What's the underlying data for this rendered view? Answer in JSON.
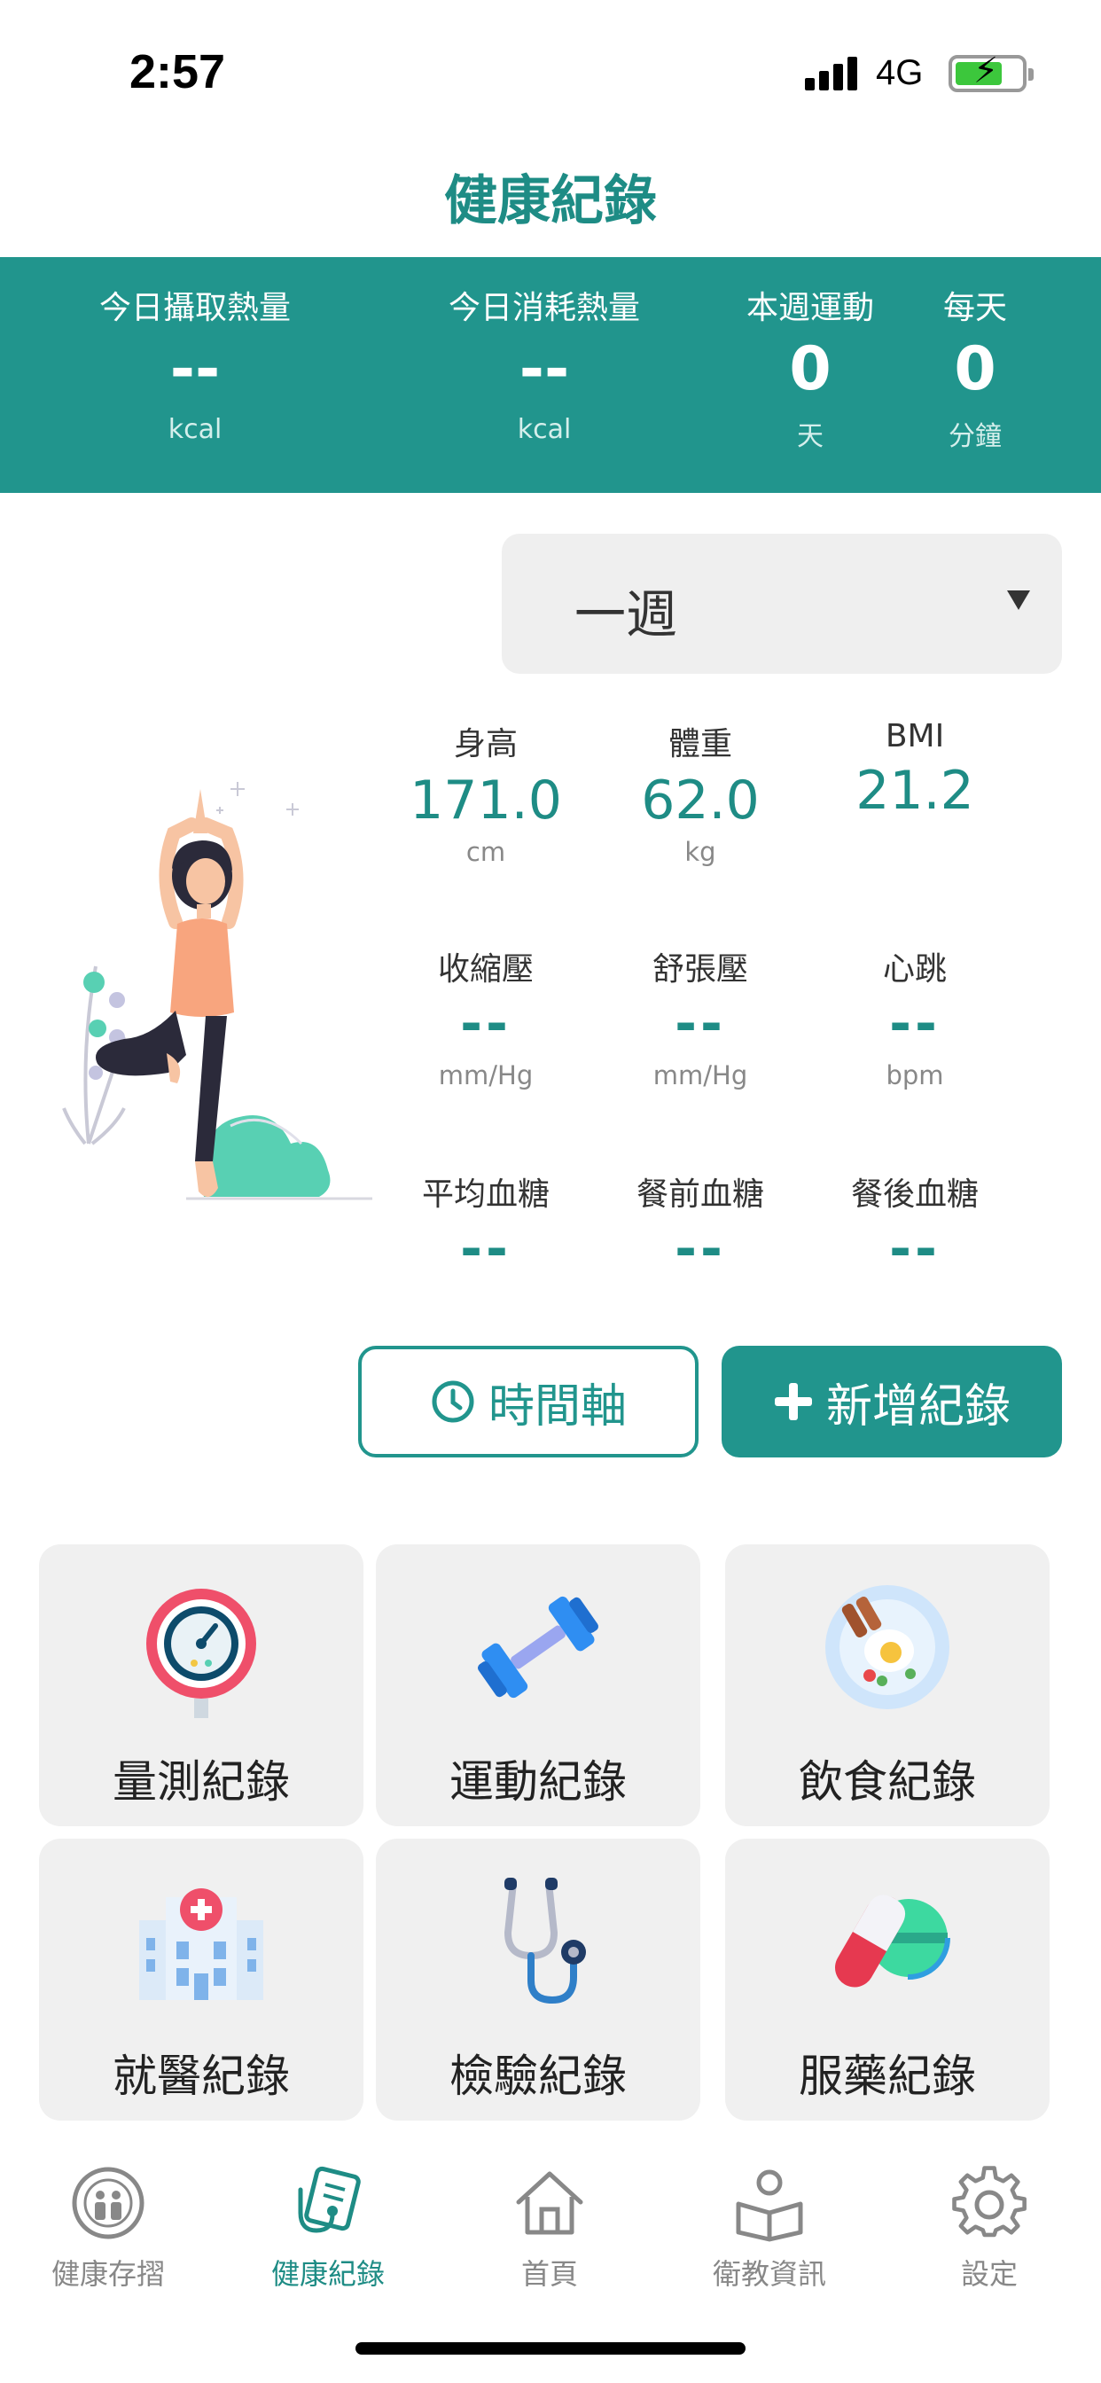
{
  "status_bar": {
    "time": "2:57",
    "network": "4G"
  },
  "header": {
    "title": "健康紀錄"
  },
  "summary": [
    {
      "label": "今日攝取熱量",
      "value": "--",
      "unit": "kcal"
    },
    {
      "label": "今日消耗熱量",
      "value": "--",
      "unit": "kcal"
    },
    {
      "label": "本週運動",
      "value": "0",
      "unit": "天"
    },
    {
      "label": "每天",
      "value": "0",
      "unit": "分鐘"
    }
  ],
  "period": {
    "selected": "一週"
  },
  "metrics": [
    {
      "label": "身高",
      "value": "171.0",
      "unit": "cm"
    },
    {
      "label": "體重",
      "value": "62.0",
      "unit": "kg"
    },
    {
      "label": "BMI",
      "value": "21.2",
      "unit": ""
    },
    {
      "label": "收縮壓",
      "value": "--",
      "unit": "mm/Hg"
    },
    {
      "label": "舒張壓",
      "value": "--",
      "unit": "mm/Hg"
    },
    {
      "label": "心跳",
      "value": "--",
      "unit": "bpm"
    },
    {
      "label": "平均血糖",
      "value": "--",
      "unit": ""
    },
    {
      "label": "餐前血糖",
      "value": "--",
      "unit": ""
    },
    {
      "label": "餐後血糖",
      "value": "--",
      "unit": ""
    }
  ],
  "actions": {
    "timeline_label": "時間軸",
    "add_label": "新增紀錄"
  },
  "tiles": [
    {
      "label": "量測紀錄",
      "icon": "gauge-icon"
    },
    {
      "label": "運動紀錄",
      "icon": "dumbbell-icon"
    },
    {
      "label": "飲食紀錄",
      "icon": "food-plate-icon"
    },
    {
      "label": "就醫紀錄",
      "icon": "hospital-icon"
    },
    {
      "label": "檢驗紀錄",
      "icon": "stethoscope-icon"
    },
    {
      "label": "服藥紀錄",
      "icon": "pills-icon"
    }
  ],
  "tabbar": [
    {
      "label": "健康存摺",
      "icon": "health-passbook-icon",
      "active": false
    },
    {
      "label": "健康紀錄",
      "icon": "health-record-icon",
      "active": true
    },
    {
      "label": "首頁",
      "icon": "home-icon",
      "active": false
    },
    {
      "label": "衛教資訊",
      "icon": "reading-person-icon",
      "active": false
    },
    {
      "label": "設定",
      "icon": "gear-icon",
      "active": false
    }
  ],
  "colors": {
    "accent": "#21958d",
    "accent_text": "#1e8c85",
    "tile_bg": "#f0f0f0"
  }
}
